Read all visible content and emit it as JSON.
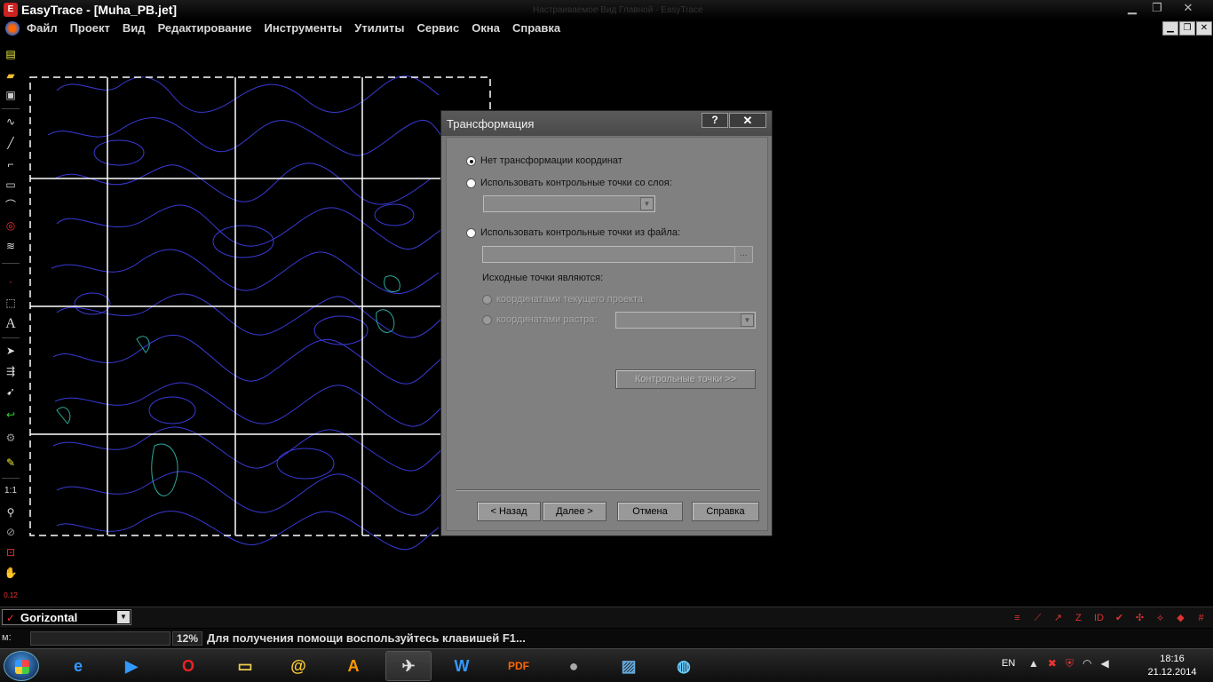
{
  "window": {
    "title": "EasyTrace - [Muha_PB.jet]",
    "ghost_title": "Настраиваемое Вид Главной - EasyTrace"
  },
  "menu": {
    "items": [
      "Файл",
      "Проект",
      "Вид",
      "Редактирование",
      "Инструменты",
      "Утилиты",
      "Сервис",
      "Окна",
      "Справка"
    ]
  },
  "dialog": {
    "title": "Трансформация",
    "help_label": "?",
    "close_label": "✕",
    "opt_none": "Нет трансформации координат",
    "opt_layer": "Использовать контрольные точки со слоя:",
    "opt_file": "Использовать контрольные точки из файла:",
    "browse_label": "...",
    "source_label": "Исходные точки являются:",
    "src_project": "координатами текущего проекта",
    "src_raster": "координатами растра:",
    "control_points_btn": "Контрольные точки >>",
    "back_btn": "< Назад",
    "next_btn": "Далее >",
    "cancel_btn": "Отмена",
    "help_btn": "Справка"
  },
  "layer": {
    "current": "Gorizontal"
  },
  "status": {
    "m_label": "м:",
    "zoom": "12%",
    "help_text": "Для получения помощи воспользуйтесь клавишей F1..."
  },
  "tray": {
    "lang": "EN",
    "time": "18:16",
    "date": "21.12.2014"
  },
  "colors": {
    "contour": "#3a3ad8",
    "contour_alt": "#2aa89a",
    "grid": "#ffffff",
    "dialog_bg": "#808080"
  }
}
